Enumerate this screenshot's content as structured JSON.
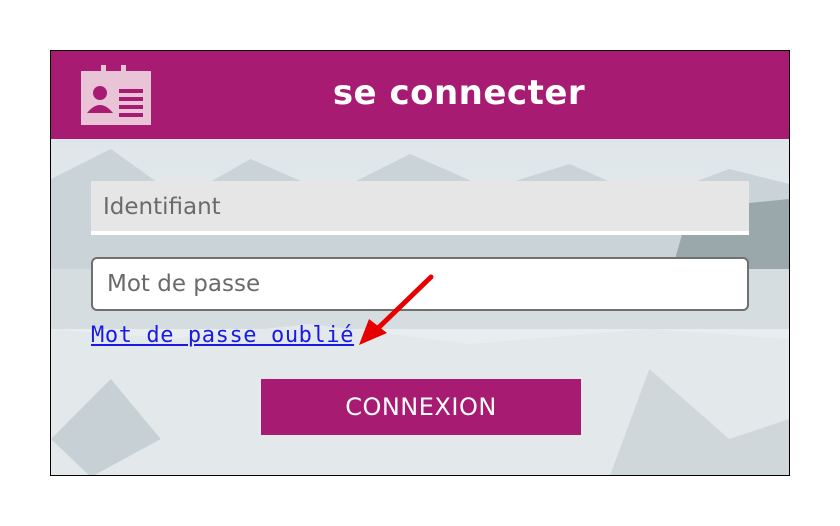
{
  "header": {
    "title": "se connecter",
    "icon": "id-badge-icon"
  },
  "form": {
    "username_placeholder": "Identifiant",
    "password_placeholder": "Mot de passe",
    "forgot_link": "Mot de passe oublié",
    "submit_label": "CONNEXION"
  },
  "colors": {
    "brand": "#a71b72",
    "link": "#1a1ae6",
    "arrow": "#e60000"
  }
}
